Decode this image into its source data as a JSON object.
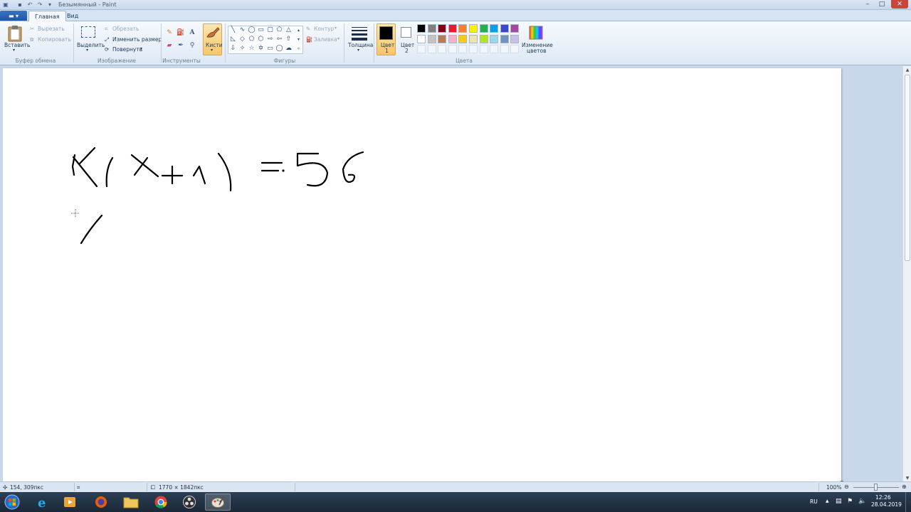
{
  "window": {
    "title": "Безымянный - Paint"
  },
  "tabs": {
    "home": "Главная",
    "view": "Вид"
  },
  "ribbon": {
    "clipboard": {
      "paste": "Вставить",
      "cut": "Вырезать",
      "copy": "Копировать",
      "group": "Буфер обмена"
    },
    "image": {
      "select": "Выделить",
      "crop": "Обрезать",
      "resize": "Изменить размер",
      "rotate": "Повернуть",
      "group": "Изображение"
    },
    "tools": {
      "group": "Инструменты",
      "text_glyph": "A"
    },
    "brushes": {
      "label": "Кисти"
    },
    "shapes": {
      "outline": "Контур",
      "fill": "Заливка",
      "group": "Фигуры"
    },
    "size": {
      "label": "Толщина"
    },
    "colors": {
      "color1_line1": "Цвет",
      "color1_line2": "1",
      "color2_line1": "Цвет",
      "color2_line2": "2",
      "edit_line1": "Изменение",
      "edit_line2": "цветов",
      "group": "Цвета",
      "color1": "#000000",
      "color2": "#ffffff",
      "palette_row1": [
        "#000000",
        "#7f7f7f",
        "#880015",
        "#ed1c24",
        "#ff7f27",
        "#fff200",
        "#22b14c",
        "#00a2e8",
        "#3f48cc",
        "#a349a4"
      ],
      "palette_row2": [
        "#ffffff",
        "#c3c3c3",
        "#b97a57",
        "#ffaec9",
        "#ffc90e",
        "#efe4b0",
        "#b5e61d",
        "#99d9ea",
        "#7092be",
        "#c8bfe7"
      ]
    }
  },
  "status": {
    "cursor_pos": "154, 309пкс",
    "image_size": "1770 × 1842пкс",
    "zoom": "100%"
  },
  "taskbar": {
    "lang": "RU",
    "time": "12:26",
    "date": "28.04.2019"
  }
}
